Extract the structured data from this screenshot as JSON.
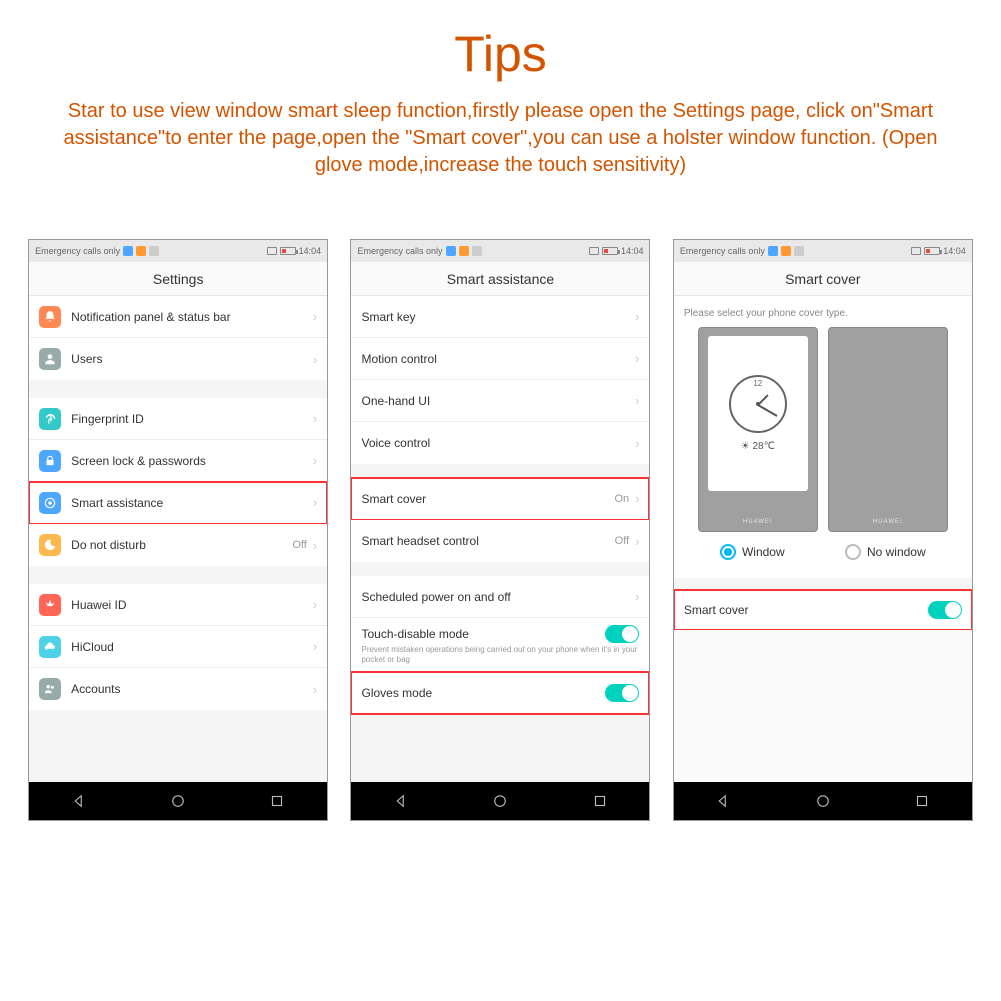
{
  "header": {
    "title": "Tips",
    "subtitle": "Star to use view window smart sleep function,firstly please open the Settings page, click on\"Smart assistance\"to enter the page,open the \"Smart cover\",you can use a holster window function. (Open glove mode,increase the touch sensitivity)"
  },
  "status": {
    "carrier": "Emergency calls only",
    "time": "14:04"
  },
  "phone1": {
    "title": "Settings",
    "items": {
      "notification": "Notification panel & status bar",
      "users": "Users",
      "fingerprint": "Fingerprint ID",
      "screenlock": "Screen lock & passwords",
      "smartassist": "Smart assistance",
      "dnd": "Do not disturb",
      "dnd_val": "Off",
      "huaweiid": "Huawei ID",
      "hicloud": "HiCloud",
      "accounts": "Accounts"
    }
  },
  "phone2": {
    "title": "Smart assistance",
    "items": {
      "smartkey": "Smart key",
      "motion": "Motion control",
      "onehand": "One-hand UI",
      "voice": "Voice control",
      "smartcover": "Smart cover",
      "smartcover_val": "On",
      "headset": "Smart headset control",
      "headset_val": "Off",
      "scheduled": "Scheduled power on and off",
      "touchdisable": "Touch-disable mode",
      "touchdisable_desc": "Prevent mistaken operations being carried out on your phone when it's in your pocket or bag",
      "gloves": "Gloves mode"
    }
  },
  "phone3": {
    "title": "Smart cover",
    "caption": "Please select your phone cover type.",
    "weather": "☀ 28℃",
    "clock12": "12",
    "brand": "HUAWEI",
    "opt_window": "Window",
    "opt_nowindow": "No window",
    "smart_cover_label": "Smart cover"
  }
}
